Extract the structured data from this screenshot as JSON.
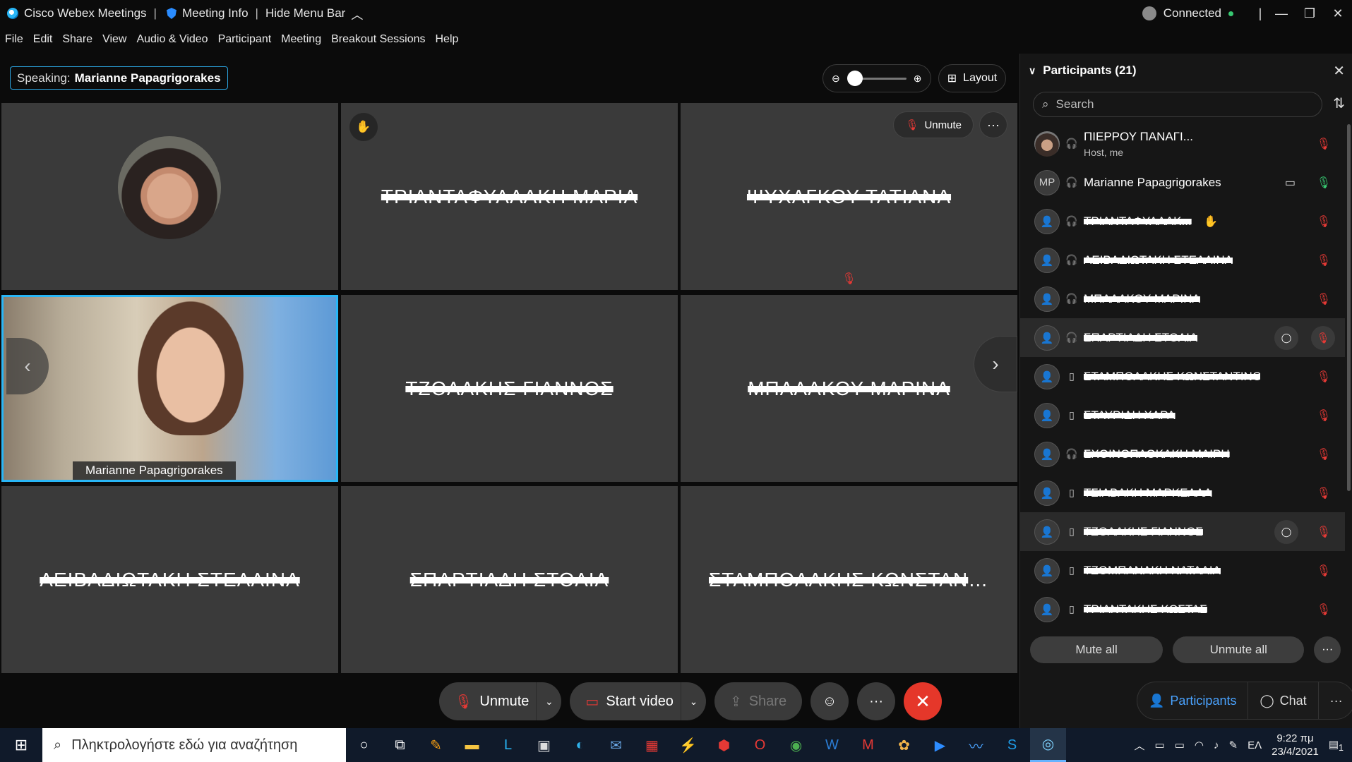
{
  "titlebar": {
    "app_title": "Cisco Webex Meetings",
    "meeting_info": "Meeting Info",
    "hide_menu": "Hide Menu Bar",
    "status": "Connected"
  },
  "menu": [
    "File",
    "Edit",
    "Share",
    "View",
    "Audio & Video",
    "Participant",
    "Meeting",
    "Breakout Sessions",
    "Help"
  ],
  "stage": {
    "speaking_label": "Speaking:",
    "speaking_name": "Marianne Papagrigorakes",
    "layout_label": "Layout",
    "unmute_label": "Unmute",
    "tiles": [
      {
        "name": ""
      },
      {
        "name": "ΤΡΙΑΝΤΑΦΥΛΛΑΚΗ ΜΑΡΙΑ"
      },
      {
        "name": "ΨΥΧΑΓΚΟΥ ΤΑΤΙΑΝΑ"
      },
      {
        "name": "Marianne Papagrigorakes"
      },
      {
        "name": "ΤΖΟΛΑΚΗΣ ΓΙΑΝΝΟΣ"
      },
      {
        "name": "ΜΠΑΛΑΚΟΥ ΜΑΡΙΝΑ"
      },
      {
        "name": "ΛΕΙΒΑΔΙΩΤΑΚΗ ΣΤΕΛΛΙΝΑ"
      },
      {
        "name": "ΣΠΑΡΤΙΑΔΗ ΣΤΟΛΙΑ"
      },
      {
        "name": "ΣΤΑΜΠΟΛΑΚΗΣ ΚΩΝΣΤΑΝΤΙΝ..."
      }
    ]
  },
  "controls": {
    "unmute": "Unmute",
    "start_video": "Start video",
    "share": "Share"
  },
  "panel": {
    "title": "Participants (21)",
    "search_placeholder": "Search",
    "participants": [
      {
        "name": "ΠΙΕΡΡΟΥ ΠΑΝΑΓΙ...",
        "sub": "Host, me",
        "initials": ""
      },
      {
        "name": "Marianne Papagrigorakes",
        "initials": "MP"
      },
      {
        "name": "ΤΡΙΑΝΤΑΦΥΛΛΑΚ..."
      },
      {
        "name": "ΛΕΙΒΑΔΙΩΤΑΚΗ ΣΤΕΛΛΙΝΑ"
      },
      {
        "name": "ΜΠΑΛΑΚΟΥ ΜΑΡΙΝΑ"
      },
      {
        "name": "ΣΠΑΡΤΙΑΔΗ ΣΤΟΛΙΑ"
      },
      {
        "name": "ΣΤΑΜΠΟΛΑΚΗΣ ΚΩΝΣΤΑΝΤΙΝΟΣ"
      },
      {
        "name": "ΣΤΑΥΡΙΔΗ ΧΑΡΑ"
      },
      {
        "name": "ΣΧΟΙΝΟΠΛΟΚΑΚΗ ΜΑΙΡΗ"
      },
      {
        "name": "ΤΣΙΑΒΑΚΗ ΜΑΡΚΕΛΛΑ"
      },
      {
        "name": "ΤΖΟΛΑΚΗΣ ΓΙΑΝΝΟΣ"
      },
      {
        "name": "ΤΖΟΜΠΑΝΑΚΗ ΝΑΤΑΛΙΑ"
      },
      {
        "name": "ΤΡΙΑΝΤΑΚΗΣ ΚΩΣΤΑΣ"
      }
    ],
    "mute_all": "Mute all",
    "unmute_all": "Unmute all",
    "tab_participants": "Participants",
    "tab_chat": "Chat"
  },
  "taskbar": {
    "search_placeholder": "Πληκτρολογήστε εδώ για αναζήτηση",
    "lang": "ΕΛ",
    "time": "9:22 πμ",
    "date": "23/4/2021",
    "notif_count": "1"
  },
  "colors": {
    "accent": "#29b6f6",
    "muted_red": "#e53935",
    "end_button": "#e5372a",
    "active_tab": "#4aa3ff"
  }
}
